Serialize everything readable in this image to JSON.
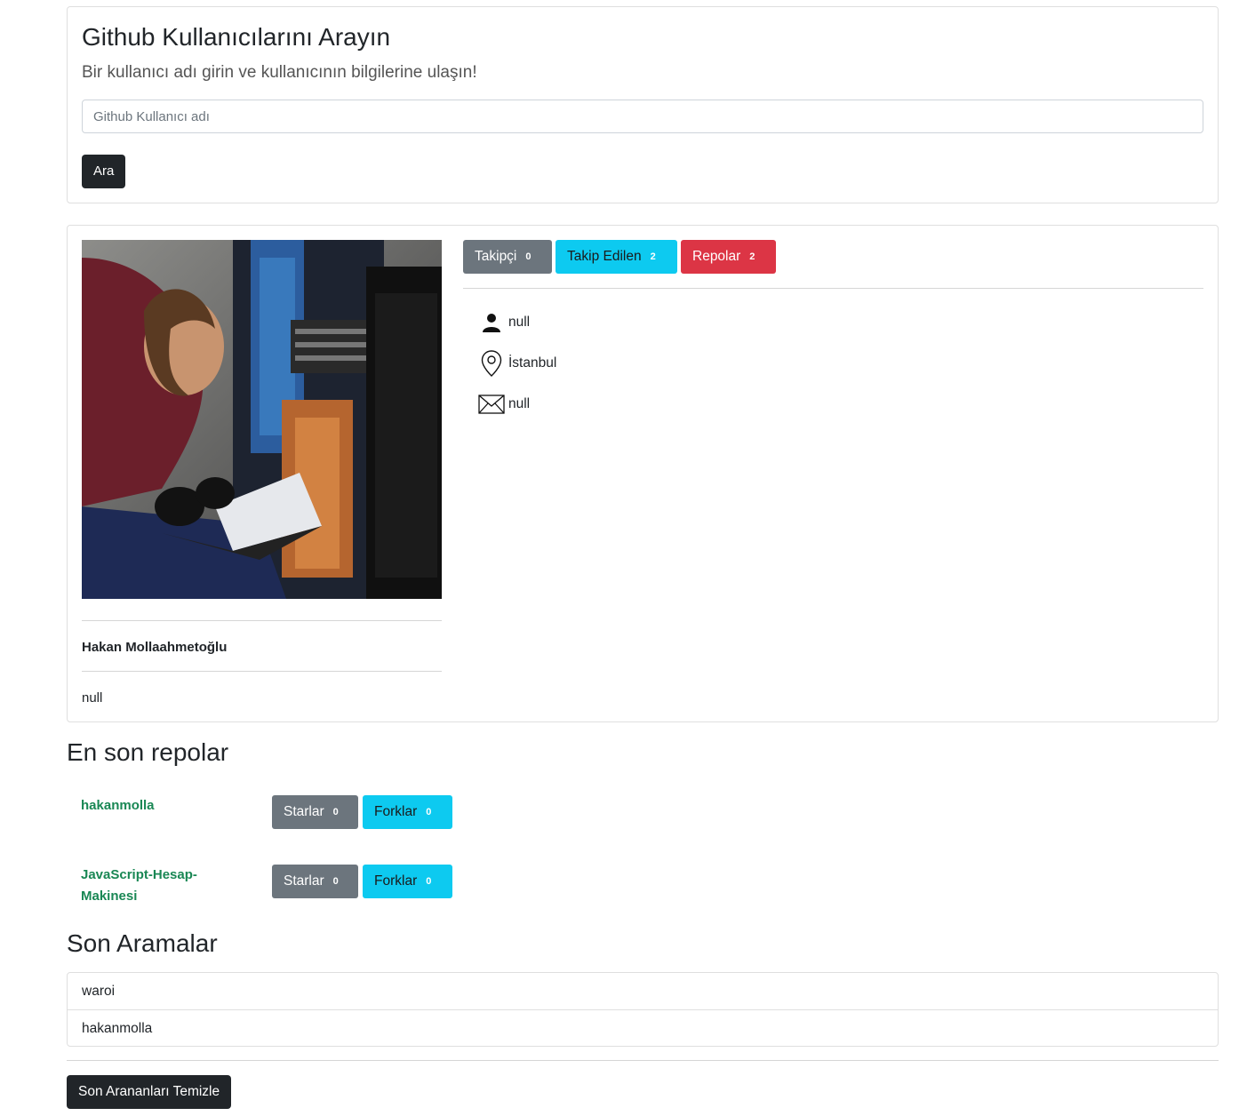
{
  "search": {
    "title": "Github Kullanıcılarını Arayın",
    "subtitle": "Bir kullanıcı adı girin ve kullanıcının bilgilerine ulaşın!",
    "placeholder": "Github Kullanıcı adı",
    "value": "",
    "button_label": "Ara"
  },
  "profile": {
    "stats": [
      {
        "label": "Takipçi",
        "count": "0"
      },
      {
        "label": "Takip Edilen",
        "count": "2"
      },
      {
        "label": "Repolar",
        "count": "2"
      }
    ],
    "name": "Hakan Mollaahmetoğlu",
    "bio": "null",
    "company": "null",
    "location": "İstanbul",
    "email": "null",
    "colors": {
      "followers": "#6c757d",
      "following": "#0dcaf0",
      "repos": "#dc3545"
    }
  },
  "repos": {
    "title": "En son repolar",
    "items": [
      {
        "name": "hakanmolla",
        "stars_label": "Starlar",
        "stars": "0",
        "forks_label": "Forklar",
        "forks": "0"
      },
      {
        "name": "JavaScript-Hesap-Makinesi",
        "stars_label": "Starlar",
        "stars": "0",
        "forks_label": "Forklar",
        "forks": "0"
      }
    ]
  },
  "recent": {
    "title": "Son Aramalar",
    "items": [
      "waroi",
      "hakanmolla"
    ],
    "clear_label": "Son Arananları Temizle"
  }
}
